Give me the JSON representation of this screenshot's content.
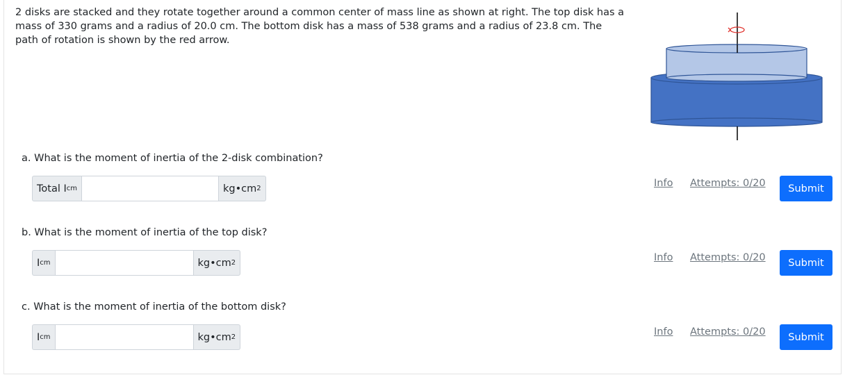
{
  "problem": {
    "text": "2 disks are stacked and they rotate together around a common center of mass line as shown at right. The top disk has a mass of 330 grams and a radius of 20.0 cm. The bottom disk has a mass of 538 grams and a radius of 23.8 cm. The path of rotation is shown by the red arrow."
  },
  "colors": {
    "top_disk": "#b4c7e7",
    "bottom_disk": "#4472c4",
    "disk_outline": "#2f5597",
    "rotation_arrow": "#e0302a",
    "submit_bg": "#0d6efd"
  },
  "parts": [
    {
      "question": "a. What is the moment of inertia of the 2-disk combination?",
      "label_main": "Total I",
      "label_sub": "cm",
      "unit_main": "kg•cm",
      "unit_sup": "2",
      "value": "",
      "info": "Info",
      "attempts": "Attempts: 0/20",
      "submit": "Submit"
    },
    {
      "question": "b. What is the moment of inertia of the top disk?",
      "label_main": "I",
      "label_sub": "cm",
      "unit_main": "kg•cm",
      "unit_sup": "2",
      "value": "",
      "info": "Info",
      "attempts": "Attempts: 0/20",
      "submit": "Submit"
    },
    {
      "question": "c. What is the moment of inertia of the bottom disk?",
      "label_main": "I",
      "label_sub": "cm",
      "unit_main": "kg•cm",
      "unit_sup": "2",
      "value": "",
      "info": "Info",
      "attempts": "Attempts: 0/20",
      "submit": "Submit"
    }
  ]
}
